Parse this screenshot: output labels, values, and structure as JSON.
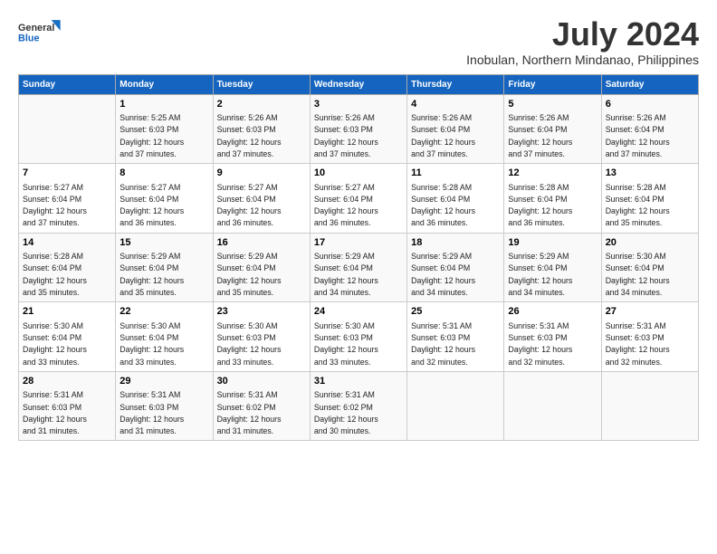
{
  "logo": {
    "line1": "General",
    "line2": "Blue"
  },
  "title": "July 2024",
  "subtitle": "Inobulan, Northern Mindanao, Philippines",
  "days_header": [
    "Sunday",
    "Monday",
    "Tuesday",
    "Wednesday",
    "Thursday",
    "Friday",
    "Saturday"
  ],
  "weeks": [
    [
      {
        "num": "",
        "text": ""
      },
      {
        "num": "1",
        "text": "Sunrise: 5:25 AM\nSunset: 6:03 PM\nDaylight: 12 hours\nand 37 minutes."
      },
      {
        "num": "2",
        "text": "Sunrise: 5:26 AM\nSunset: 6:03 PM\nDaylight: 12 hours\nand 37 minutes."
      },
      {
        "num": "3",
        "text": "Sunrise: 5:26 AM\nSunset: 6:03 PM\nDaylight: 12 hours\nand 37 minutes."
      },
      {
        "num": "4",
        "text": "Sunrise: 5:26 AM\nSunset: 6:04 PM\nDaylight: 12 hours\nand 37 minutes."
      },
      {
        "num": "5",
        "text": "Sunrise: 5:26 AM\nSunset: 6:04 PM\nDaylight: 12 hours\nand 37 minutes."
      },
      {
        "num": "6",
        "text": "Sunrise: 5:26 AM\nSunset: 6:04 PM\nDaylight: 12 hours\nand 37 minutes."
      }
    ],
    [
      {
        "num": "7",
        "text": "Sunrise: 5:27 AM\nSunset: 6:04 PM\nDaylight: 12 hours\nand 37 minutes."
      },
      {
        "num": "8",
        "text": "Sunrise: 5:27 AM\nSunset: 6:04 PM\nDaylight: 12 hours\nand 36 minutes."
      },
      {
        "num": "9",
        "text": "Sunrise: 5:27 AM\nSunset: 6:04 PM\nDaylight: 12 hours\nand 36 minutes."
      },
      {
        "num": "10",
        "text": "Sunrise: 5:27 AM\nSunset: 6:04 PM\nDaylight: 12 hours\nand 36 minutes."
      },
      {
        "num": "11",
        "text": "Sunrise: 5:28 AM\nSunset: 6:04 PM\nDaylight: 12 hours\nand 36 minutes."
      },
      {
        "num": "12",
        "text": "Sunrise: 5:28 AM\nSunset: 6:04 PM\nDaylight: 12 hours\nand 36 minutes."
      },
      {
        "num": "13",
        "text": "Sunrise: 5:28 AM\nSunset: 6:04 PM\nDaylight: 12 hours\nand 35 minutes."
      }
    ],
    [
      {
        "num": "14",
        "text": "Sunrise: 5:28 AM\nSunset: 6:04 PM\nDaylight: 12 hours\nand 35 minutes."
      },
      {
        "num": "15",
        "text": "Sunrise: 5:29 AM\nSunset: 6:04 PM\nDaylight: 12 hours\nand 35 minutes."
      },
      {
        "num": "16",
        "text": "Sunrise: 5:29 AM\nSunset: 6:04 PM\nDaylight: 12 hours\nand 35 minutes."
      },
      {
        "num": "17",
        "text": "Sunrise: 5:29 AM\nSunset: 6:04 PM\nDaylight: 12 hours\nand 34 minutes."
      },
      {
        "num": "18",
        "text": "Sunrise: 5:29 AM\nSunset: 6:04 PM\nDaylight: 12 hours\nand 34 minutes."
      },
      {
        "num": "19",
        "text": "Sunrise: 5:29 AM\nSunset: 6:04 PM\nDaylight: 12 hours\nand 34 minutes."
      },
      {
        "num": "20",
        "text": "Sunrise: 5:30 AM\nSunset: 6:04 PM\nDaylight: 12 hours\nand 34 minutes."
      }
    ],
    [
      {
        "num": "21",
        "text": "Sunrise: 5:30 AM\nSunset: 6:04 PM\nDaylight: 12 hours\nand 33 minutes."
      },
      {
        "num": "22",
        "text": "Sunrise: 5:30 AM\nSunset: 6:04 PM\nDaylight: 12 hours\nand 33 minutes."
      },
      {
        "num": "23",
        "text": "Sunrise: 5:30 AM\nSunset: 6:03 PM\nDaylight: 12 hours\nand 33 minutes."
      },
      {
        "num": "24",
        "text": "Sunrise: 5:30 AM\nSunset: 6:03 PM\nDaylight: 12 hours\nand 33 minutes."
      },
      {
        "num": "25",
        "text": "Sunrise: 5:31 AM\nSunset: 6:03 PM\nDaylight: 12 hours\nand 32 minutes."
      },
      {
        "num": "26",
        "text": "Sunrise: 5:31 AM\nSunset: 6:03 PM\nDaylight: 12 hours\nand 32 minutes."
      },
      {
        "num": "27",
        "text": "Sunrise: 5:31 AM\nSunset: 6:03 PM\nDaylight: 12 hours\nand 32 minutes."
      }
    ],
    [
      {
        "num": "28",
        "text": "Sunrise: 5:31 AM\nSunset: 6:03 PM\nDaylight: 12 hours\nand 31 minutes."
      },
      {
        "num": "29",
        "text": "Sunrise: 5:31 AM\nSunset: 6:03 PM\nDaylight: 12 hours\nand 31 minutes."
      },
      {
        "num": "30",
        "text": "Sunrise: 5:31 AM\nSunset: 6:02 PM\nDaylight: 12 hours\nand 31 minutes."
      },
      {
        "num": "31",
        "text": "Sunrise: 5:31 AM\nSunset: 6:02 PM\nDaylight: 12 hours\nand 30 minutes."
      },
      {
        "num": "",
        "text": ""
      },
      {
        "num": "",
        "text": ""
      },
      {
        "num": "",
        "text": ""
      }
    ]
  ]
}
